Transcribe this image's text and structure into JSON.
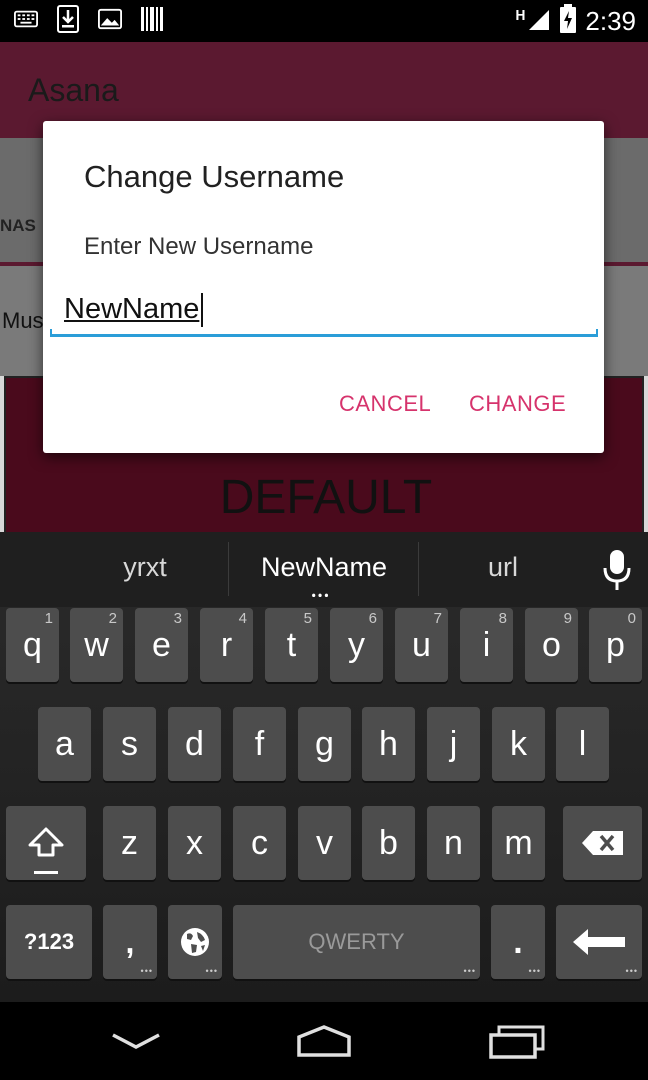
{
  "status_bar": {
    "time": "2:39",
    "network": "H",
    "icons_left": [
      "keyboard-icon",
      "download-icon",
      "image-icon",
      "barcode-icon"
    ],
    "icons_right": [
      "signal-icon",
      "battery-charging-icon"
    ]
  },
  "app": {
    "title": "Asana",
    "tab_fragment": "NAS",
    "row_fragment": "Mus",
    "default_label": "DEFAULT",
    "colors": {
      "actionbar": "#5b1930",
      "default_area": "#4a0a1c"
    }
  },
  "dialog": {
    "title": "Change Username",
    "message": "Enter New Username",
    "input_value": "NewName",
    "cancel_label": "CANCEL",
    "change_label": "CHANGE",
    "accent": "#d6336c",
    "input_line_color": "#2a9dd8"
  },
  "keyboard": {
    "suggestions": [
      "yrxt",
      "NewName",
      "url"
    ],
    "row1": [
      {
        "ch": "q",
        "hint": "1"
      },
      {
        "ch": "w",
        "hint": "2"
      },
      {
        "ch": "e",
        "hint": "3"
      },
      {
        "ch": "r",
        "hint": "4"
      },
      {
        "ch": "t",
        "hint": "5"
      },
      {
        "ch": "y",
        "hint": "6"
      },
      {
        "ch": "u",
        "hint": "7"
      },
      {
        "ch": "i",
        "hint": "8"
      },
      {
        "ch": "o",
        "hint": "9"
      },
      {
        "ch": "p",
        "hint": "0"
      }
    ],
    "row2": [
      "a",
      "s",
      "d",
      "f",
      "g",
      "h",
      "j",
      "k",
      "l"
    ],
    "row3": [
      "z",
      "x",
      "c",
      "v",
      "b",
      "n",
      "m"
    ],
    "symbols_label": "?123",
    "comma_label": ",",
    "space_label": "QWERTY",
    "period_label": "."
  },
  "nav_bar": {
    "buttons": [
      "back-icon",
      "home-icon",
      "recents-icon"
    ]
  }
}
